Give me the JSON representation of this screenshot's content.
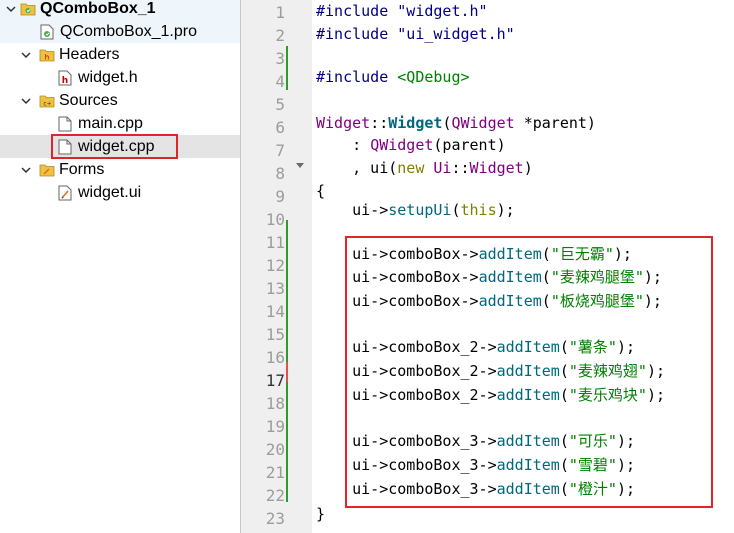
{
  "tree": {
    "project": "QComboBox_1",
    "pro_file": "QComboBox_1.pro",
    "headers_label": "Headers",
    "header_file": "widget.h",
    "sources_label": "Sources",
    "main_file": "main.cpp",
    "widget_cpp": "widget.cpp",
    "forms_label": "Forms",
    "ui_file": "widget.ui"
  },
  "editor": {
    "current_line": 17,
    "line_numbers": [
      "1",
      "2",
      "3",
      "4",
      "5",
      "6",
      "7",
      "8",
      "9",
      "10",
      "11",
      "12",
      "13",
      "14",
      "15",
      "16",
      "17",
      "18",
      "19",
      "20",
      "21",
      "22",
      "23"
    ],
    "lines": {
      "l1_kw": "#include",
      "l1_str": "\"widget.h\"",
      "l2_kw": "#include",
      "l2_str": "\"ui_widget.h\"",
      "l4_kw": "#include",
      "l4_str": "<QDebug>",
      "l6_a": "Widget",
      "l6_b": "::",
      "l6_c": "Widget",
      "l6_d": "(",
      "l6_e": "QWidget",
      "l6_f": " *parent)",
      "l7_a": "    : ",
      "l7_b": "QWidget",
      "l7_c": "(parent)",
      "l8_a": "    , ui(",
      "l8_b": "new",
      "l8_c": " ",
      "l8_d": "Ui",
      "l8_e": "::",
      "l8_f": "Widget",
      "l8_g": ")",
      "l9": "{",
      "l10_a": "    ui->",
      "l10_b": "setupUi",
      "l10_c": "(",
      "l10_d": "this",
      "l10_e": ");",
      "l12_a": "    ui->comboBox->",
      "l12_b": "addItem",
      "l12_c": "(",
      "l12_d": "\"巨无霸\"",
      "l12_e": ");",
      "l13_a": "    ui->comboBox->",
      "l13_b": "addItem",
      "l13_c": "(",
      "l13_d": "\"麦辣鸡腿堡\"",
      "l13_e": ");",
      "l14_a": "    ui->comboBox->",
      "l14_b": "addItem",
      "l14_c": "(",
      "l14_d": "\"板烧鸡腿堡\"",
      "l14_e": ");",
      "l16_a": "    ui->comboBox_2->",
      "l16_b": "addItem",
      "l16_c": "(",
      "l16_d": "\"薯条\"",
      "l16_e": ");",
      "l17_a": "    ui->comboBox_2->",
      "l17_b": "addItem",
      "l17_c": "(",
      "l17_d": "\"麦辣鸡翅\"",
      "l17_e": ");",
      "l18_a": "    ui->comboBox_2->",
      "l18_b": "addItem",
      "l18_c": "(",
      "l18_d": "\"麦乐鸡块\"",
      "l18_e": ");",
      "l20_a": "    ui->comboBox_3->",
      "l20_b": "addItem",
      "l20_c": "(",
      "l20_d": "\"可乐\"",
      "l20_e": ");",
      "l21_a": "    ui->comboBox_3->",
      "l21_b": "addItem",
      "l21_c": "(",
      "l21_d": "\"雪碧\"",
      "l21_e": ");",
      "l22_a": "    ui->comboBox_3->",
      "l22_b": "addItem",
      "l22_c": "(",
      "l22_d": "\"橙汁\"",
      "l22_e": ");",
      "l23": "}"
    }
  },
  "colors": {
    "keyword": "#808000",
    "preprocessor": "#000080",
    "string": "#008000",
    "type": "#800080",
    "function": "#00677c",
    "highlight_border": "#e0242b",
    "gutter_bg": "#efefef",
    "change_marker": "#2e9b2e"
  }
}
